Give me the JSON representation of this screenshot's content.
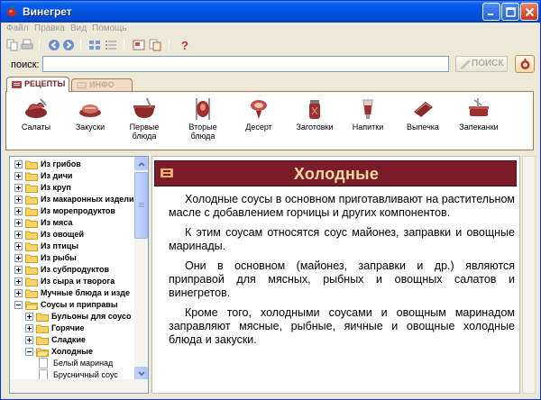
{
  "window": {
    "title": "Винегрет"
  },
  "menu": [
    "Файл",
    "Правка",
    "Вид",
    "Помощь"
  ],
  "search": {
    "label": "поиск:",
    "value": "",
    "button_label": "ПОИСК"
  },
  "tabs": [
    {
      "label": "РЕЦЕПТЫ",
      "active": true
    },
    {
      "label": "ИНФО",
      "active": false
    }
  ],
  "categories": [
    {
      "label": "Салаты",
      "icon": "salad-icon"
    },
    {
      "label": "Закуски",
      "icon": "appetizer-icon"
    },
    {
      "label": "Первые блюда",
      "icon": "soup-icon"
    },
    {
      "label": "Вторые блюда",
      "icon": "main-course-icon"
    },
    {
      "label": "Десерт",
      "icon": "dessert-icon"
    },
    {
      "label": "Заготовки",
      "icon": "preserves-icon"
    },
    {
      "label": "Напитки",
      "icon": "drinks-icon"
    },
    {
      "label": "Выпечка",
      "icon": "bakery-icon"
    },
    {
      "label": "Запеканки",
      "icon": "casserole-icon"
    }
  ],
  "tree": [
    {
      "label": "Из грибов",
      "level": 0,
      "expanded": false
    },
    {
      "label": "Из дичи",
      "level": 0,
      "expanded": false
    },
    {
      "label": "Из круп",
      "level": 0,
      "expanded": false
    },
    {
      "label": "Из макаронных издели",
      "level": 0,
      "expanded": false
    },
    {
      "label": "Из морепродуктов",
      "level": 0,
      "expanded": false
    },
    {
      "label": "Из мяса",
      "level": 0,
      "expanded": false
    },
    {
      "label": "Из овощей",
      "level": 0,
      "expanded": false
    },
    {
      "label": "Из птицы",
      "level": 0,
      "expanded": false
    },
    {
      "label": "Из рыбы",
      "level": 0,
      "expanded": false
    },
    {
      "label": "Из субпродуктов",
      "level": 0,
      "expanded": false
    },
    {
      "label": "Из сыра и творога",
      "level": 0,
      "expanded": false
    },
    {
      "label": "Мучные блюда и изде",
      "level": 0,
      "expanded": false
    },
    {
      "label": "Соусы и приправы",
      "level": 0,
      "expanded": true
    },
    {
      "label": "Бульоны для соусо",
      "level": 1,
      "expanded": false
    },
    {
      "label": "Горячие",
      "level": 1,
      "expanded": false
    },
    {
      "label": "Сладкие",
      "level": 1,
      "expanded": false
    },
    {
      "label": "Холодные",
      "level": 1,
      "expanded": true
    },
    {
      "label": "Белый маринад",
      "level": 2,
      "leaf": true
    },
    {
      "label": "Брусничный соус",
      "level": 2,
      "leaf": true
    }
  ],
  "content": {
    "title": "Холодные",
    "paragraphs": [
      "Холодные соусы в основном приготавливают на растительном масле с добавлением горчицы и других компонентов.",
      "К этим соусам относятся соус майонез, заправки и овощные маринады.",
      "Они в основном (майонез, заправки и др.) являются приправой для мясных, рыбных и овощных салатов и винегретов.",
      "Кроме того, холодными соусами и овощным маринадом заправляют мясные, рыбные, яичные и овощные холодные блюда и закуски."
    ]
  },
  "colors": {
    "accent": "#7a1c2a",
    "header_text": "#f7d8a0",
    "titlebar": "#0054e3"
  }
}
